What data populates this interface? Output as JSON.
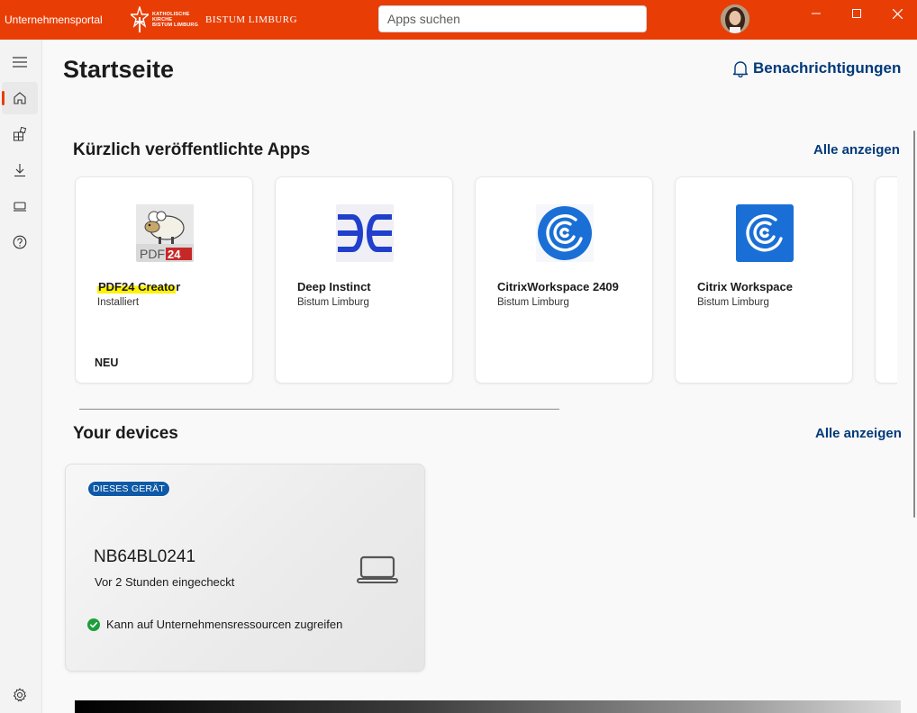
{
  "titlebar": {
    "app_title": "Unternehmensportal",
    "brand_small_lines": [
      "KATHOLISCHE",
      "KIRCHE",
      "BISTUM LIMBURG"
    ],
    "brand_name": "BISTUM LIMBURG",
    "search_placeholder": "Apps suchen",
    "accent_color": "#e83e06"
  },
  "window_controls": [
    "minimize",
    "maximize",
    "close"
  ],
  "nav": {
    "items": [
      {
        "name": "menu",
        "icon": "hamburger-icon"
      },
      {
        "name": "home",
        "icon": "home-icon",
        "active": true
      },
      {
        "name": "apps",
        "icon": "apps-icon"
      },
      {
        "name": "downloads",
        "icon": "download-icon"
      },
      {
        "name": "devices",
        "icon": "laptop-icon"
      },
      {
        "name": "help",
        "icon": "help-icon"
      },
      {
        "name": "settings",
        "icon": "gear-icon"
      }
    ]
  },
  "page": {
    "title": "Startseite",
    "notifications_label": "Benachrichtigungen"
  },
  "recent_apps": {
    "title": "Kürzlich veröffentlichte Apps",
    "see_all": "Alle anzeigen",
    "apps": [
      {
        "name_highlighted": "PDF24 Creato",
        "name_rest": "r",
        "subtitle": "Installiert",
        "badge": "NEU",
        "icon": "pdf24-icon"
      },
      {
        "name": "Deep Instinct",
        "subtitle": "Bistum Limburg",
        "icon": "deep-instinct-icon"
      },
      {
        "name": "CitrixWorkspace 2409",
        "subtitle": "Bistum Limburg",
        "icon": "citrix-icon"
      },
      {
        "name": "Citrix Workspace",
        "subtitle": "Bistum Limburg",
        "icon": "citrix-icon"
      }
    ]
  },
  "devices": {
    "title": "Your devices",
    "see_all": "Alle anzeigen",
    "device": {
      "badge": "DIESES GERÄT",
      "name": "NB64BL0241",
      "checked_in": "Vor 2 Stunden eingecheckt",
      "status": "Kann auf Unternehmensressourcen zugreifen",
      "status_color": "#1e9e3a",
      "icon": "laptop-icon"
    }
  }
}
